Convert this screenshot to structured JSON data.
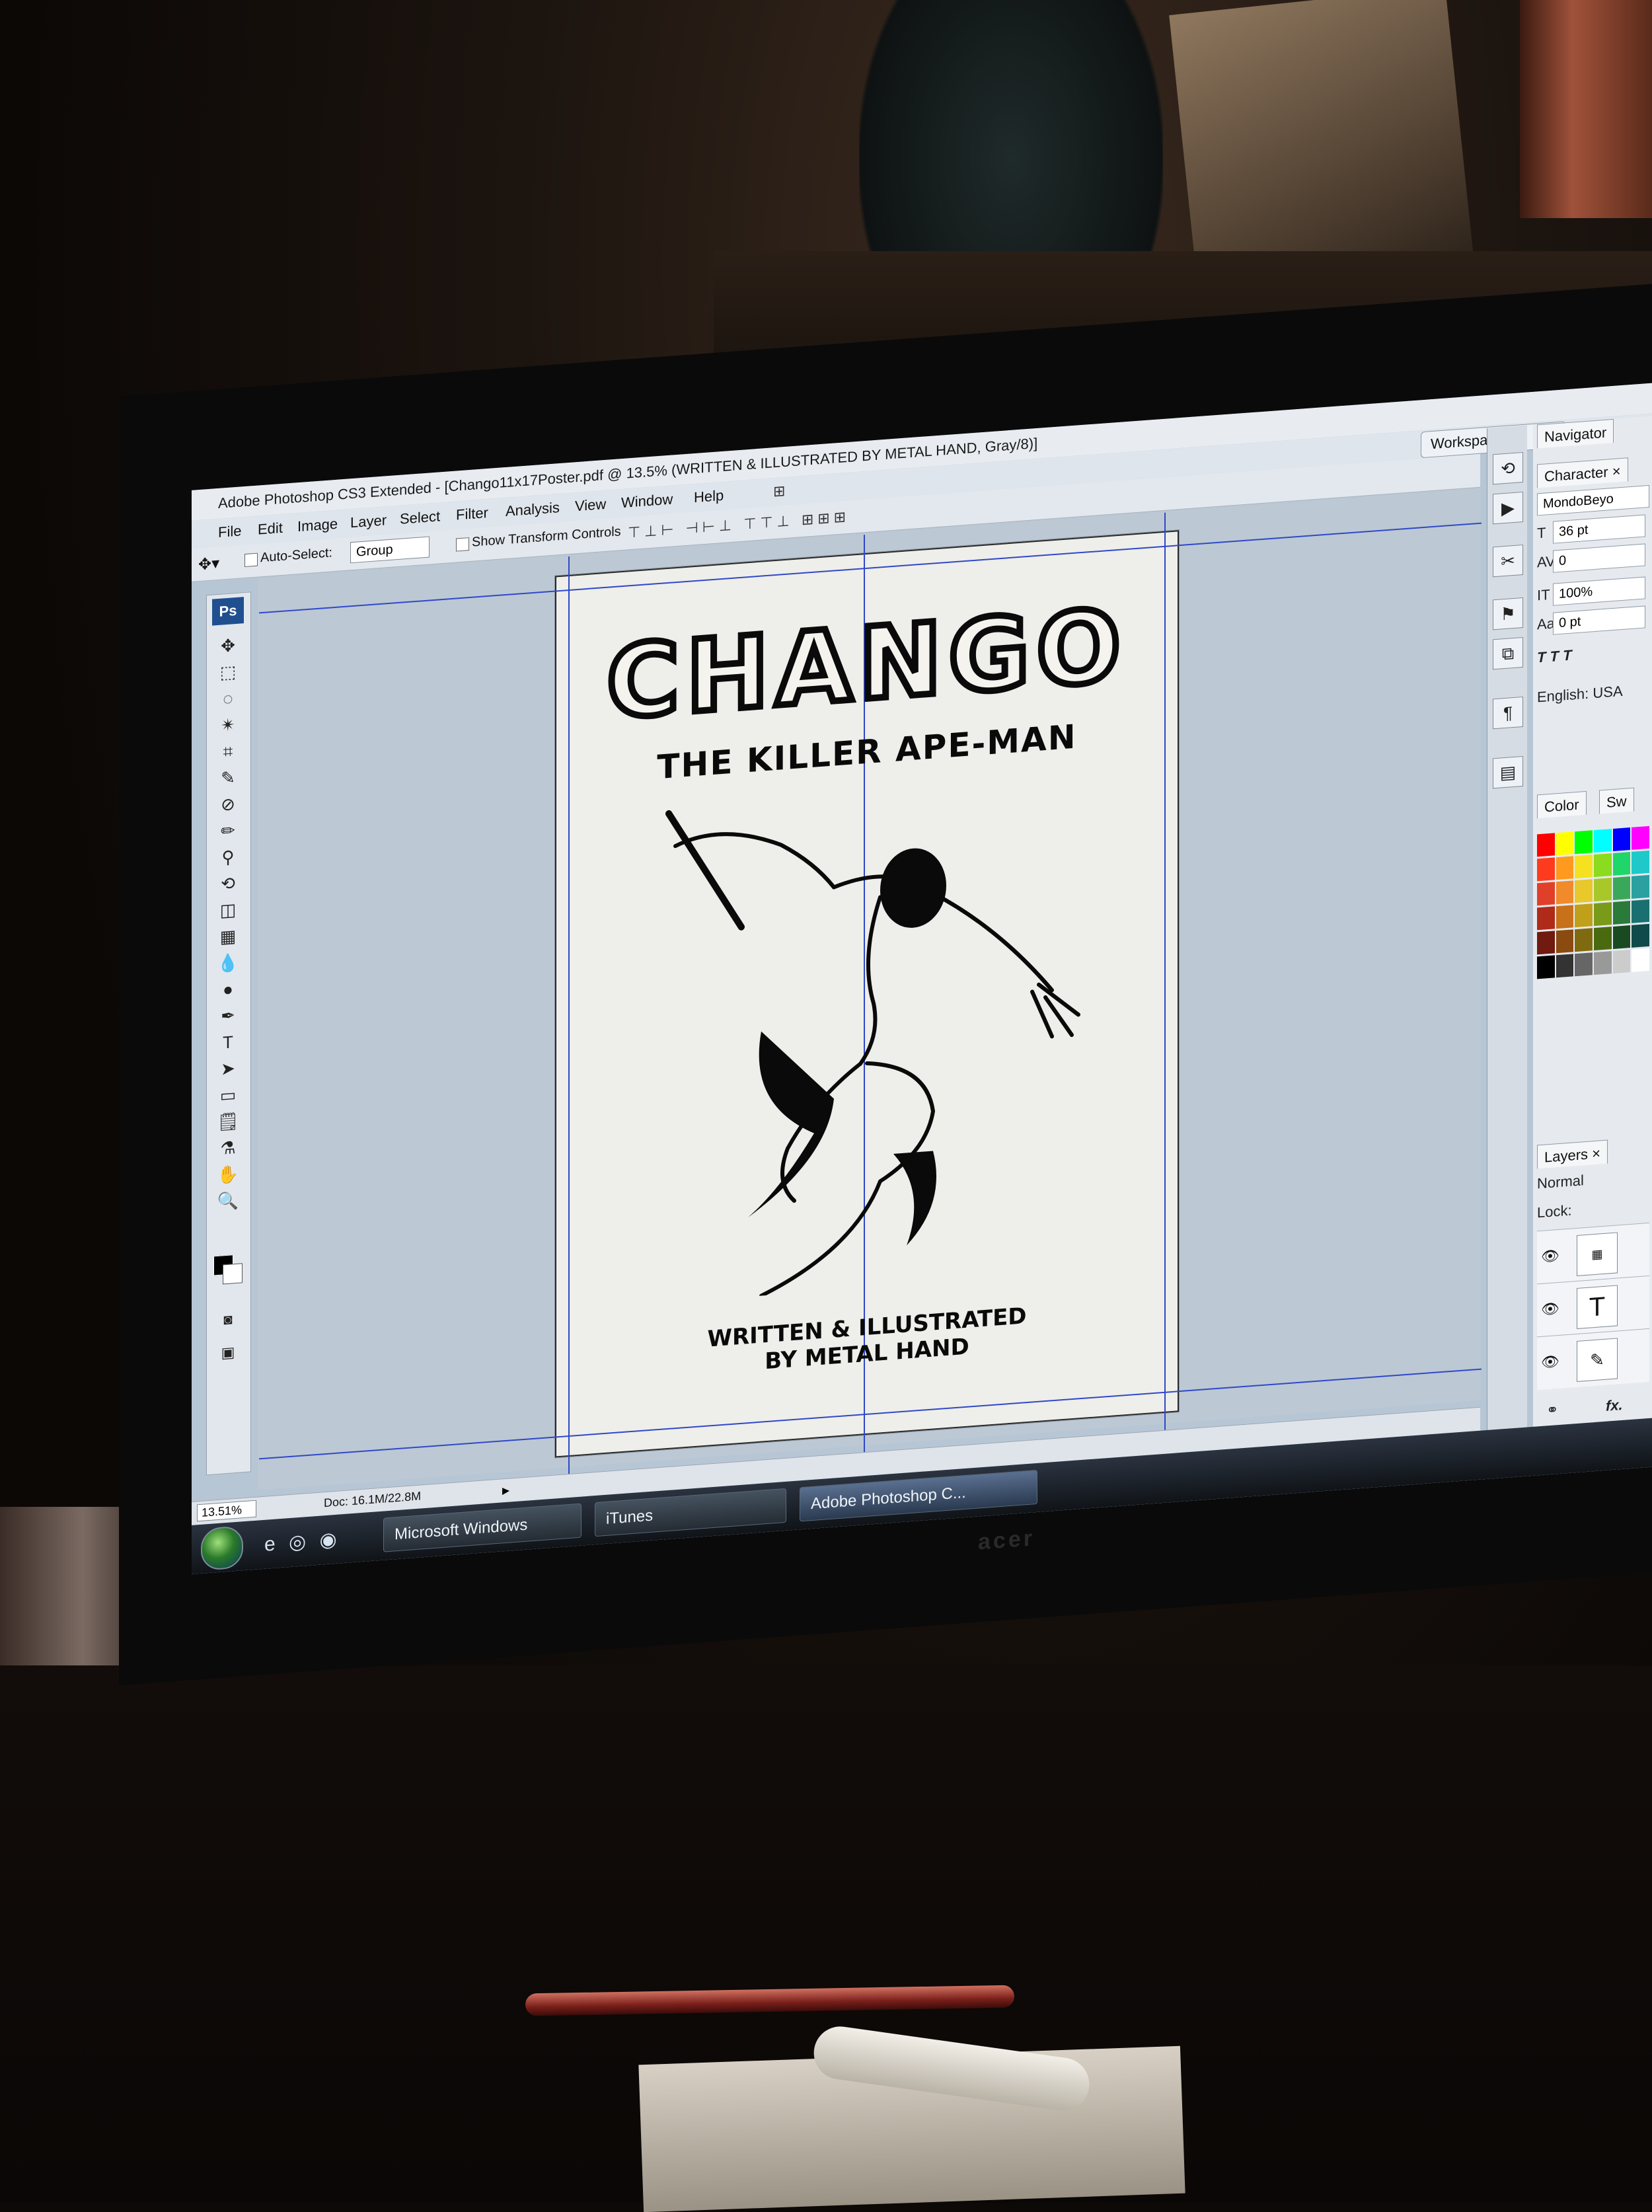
{
  "window": {
    "title": "Adobe Photoshop CS3 Extended - [Chango11x17Poster.pdf @ 13.5% (WRITTEN & ILLUSTRATED BY METAL HAND, Gray/8)]"
  },
  "menu": [
    "File",
    "Edit",
    "Image",
    "Layer",
    "Select",
    "Filter",
    "Analysis",
    "View",
    "Window",
    "Help"
  ],
  "workspace_label": "Workspace ▾",
  "options": {
    "auto_select_label": "Auto-Select:",
    "auto_select_value": "Group",
    "show_transform_label": "Show Transform Controls",
    "align_icons": "⊤⊥⊢ ⊣⊢⊥ ⊤⊤⊥ ⊞⊞⊞"
  },
  "toolbox": {
    "logo": "Ps",
    "tools": [
      "move-tool",
      "marquee-tool",
      "lasso-tool",
      "magic-wand-tool",
      "crop-tool",
      "slice-tool",
      "healing-brush-tool",
      "brush-tool",
      "clone-stamp-tool",
      "history-brush-tool",
      "eraser-tool",
      "gradient-tool",
      "blur-tool",
      "dodge-tool",
      "pen-tool",
      "type-tool",
      "path-selection-tool",
      "shape-tool",
      "notes-tool",
      "eyedropper-tool",
      "hand-tool",
      "zoom-tool"
    ],
    "tool_glyphs": [
      "✥",
      "⬚",
      "◌",
      "✴",
      "⌗",
      "✎",
      "⊘",
      "✏",
      "⚲",
      "⟲",
      "◫",
      "▦",
      "💧",
      "●",
      "✒",
      "T",
      "➤",
      "▭",
      "🗒",
      "⚗",
      "✋",
      "🔍"
    ]
  },
  "poster": {
    "title": "CHANGO",
    "subtitle": "THE KILLER APE-MAN",
    "credit_line1": "WRITTEN & ILLUSTRATED",
    "credit_line2": "BY METAL HAND"
  },
  "status": {
    "zoom": "13.51%",
    "doc": "Doc: 16.1M/22.8M"
  },
  "taskbar": {
    "quick_launch": "e ◎ ◉",
    "buttons": [
      "Microsoft Windows",
      "iTunes",
      "Adobe Photoshop C..."
    ]
  },
  "panels": {
    "navigator_tab": "Navigator",
    "character_tab": "Character ×",
    "font_family": "MondoBeyo",
    "font_size": "36 pt",
    "tracking": "0",
    "vertical_scale": "100%",
    "baseline": "0 pt",
    "style_glyphs": "T T T",
    "language": "English: USA",
    "color_tab": "Color",
    "swatches_tab": "Sw",
    "layers_tab": "Layers ×",
    "blend_mode": "Normal",
    "lock_label": "Lock:",
    "layer_thumb_text": "T",
    "fx_label": "fx."
  },
  "colors": {
    "swatch_grid": [
      "#ff0000",
      "#ffff00",
      "#00ff00",
      "#00ffff",
      "#0000ff",
      "#ff00ff",
      "#ff3b1f",
      "#ff9a1f",
      "#f5e11f",
      "#8bdc1f",
      "#1fd66a",
      "#1fc9c9",
      "#e0402a",
      "#f08a2a",
      "#e8c82a",
      "#a8c82a",
      "#3aa85a",
      "#2aa0a0",
      "#b02a1a",
      "#c8701a",
      "#c0a01a",
      "#7a9a1a",
      "#2a7a3a",
      "#1a7070",
      "#701a10",
      "#8a4a10",
      "#806a10",
      "#4a6a10",
      "#1a4a20",
      "#104a4a",
      "#000000",
      "#333333",
      "#666666",
      "#999999",
      "#cccccc",
      "#ffffff"
    ]
  }
}
